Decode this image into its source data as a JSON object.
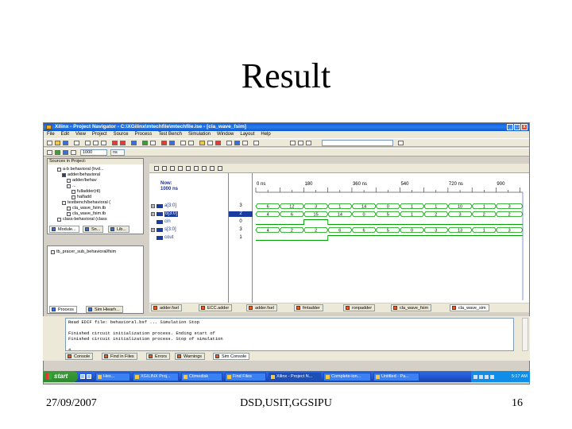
{
  "slide": {
    "title": "Result",
    "footer_left": "27/09/2007",
    "footer_center": "DSD,USIT,GGSIPU",
    "footer_right": "16"
  },
  "window": {
    "title": "Xilinx - Project Navigator - C:\\XGilinx\\mtechfile\\mtechfile.ise - [cla_wave_fsim]",
    "controls": [
      "_",
      "□",
      "x"
    ]
  },
  "menu": [
    "File",
    "Edit",
    "View",
    "Project",
    "Source",
    "Process",
    "Test Bench",
    "Simulation",
    "Window",
    "Layout",
    "Help"
  ],
  "toolbar": {
    "zoom_value": "1000",
    "zoom_unit": "ns"
  },
  "sources_panel": {
    "title": "Sources in Project:",
    "items": [
      "a-b behavioral (hvd...",
      "adder/behavioral",
      "adder/behav",
      "...",
      "fulladder(rtl)",
      "halfadd",
      "testbench/behavioral (",
      "cla_wave_fsim.tb",
      "cla_wave_fsim.tb",
      "class-behavioral (class"
    ],
    "tabs": [
      "Module...",
      "Sn...",
      "Lib..."
    ]
  },
  "process_panel": {
    "item": "tb_pracer_sub_behavioral/fsim",
    "tabs": [
      "Process",
      "Sim Hiearh..."
    ]
  },
  "wave": {
    "now_label": "Now:",
    "now_value": "1000 ns",
    "time_ticks": [
      "0 ns",
      "180",
      "360 ns",
      "540",
      "720 ns",
      "900"
    ],
    "signals": [
      {
        "name": "a[3:0]",
        "value": "3",
        "kind": "bus"
      },
      {
        "name": "b[3:0]",
        "value": "2",
        "kind": "bus"
      },
      {
        "name": "cin",
        "value": "0",
        "kind": "bit"
      },
      {
        "name": "s[3:0]",
        "value": "3",
        "kind": "bus"
      },
      {
        "name": "cout",
        "value": "1",
        "kind": "bit"
      }
    ],
    "tabs": [
      "adder.fsel",
      "ECC.adder",
      "adder.fsel",
      "fmtadder",
      "ronpadder",
      "cla_wave_fsim",
      "cla_wave_sim"
    ]
  },
  "chart_data": {
    "type": "timing",
    "x_unit": "ns",
    "xlim": [
      0,
      1000
    ],
    "buses": [
      {
        "name": "a[3:0]",
        "segments": [
          [
            0,
            90,
            "6"
          ],
          [
            90,
            180,
            "12"
          ],
          [
            180,
            270,
            "3"
          ],
          [
            270,
            360,
            "1"
          ],
          [
            360,
            450,
            "14"
          ],
          [
            450,
            540,
            "0"
          ],
          [
            540,
            630,
            "1"
          ],
          [
            630,
            720,
            "1"
          ],
          [
            720,
            810,
            "10"
          ],
          [
            810,
            900,
            "1"
          ],
          [
            900,
            1000,
            "3"
          ]
        ]
      },
      {
        "name": "b[3:0]",
        "segments": [
          [
            0,
            90,
            "4"
          ],
          [
            90,
            180,
            "6"
          ],
          [
            180,
            270,
            "15"
          ],
          [
            270,
            360,
            "14"
          ],
          [
            360,
            450,
            "0"
          ],
          [
            450,
            540,
            "5"
          ],
          [
            540,
            630,
            "1"
          ],
          [
            630,
            720,
            "2"
          ],
          [
            720,
            810,
            "3"
          ],
          [
            810,
            900,
            "2"
          ],
          [
            900,
            1000,
            "2"
          ]
        ]
      },
      {
        "name": "s[3:0]",
        "segments": [
          [
            0,
            90,
            "4"
          ],
          [
            90,
            180,
            "2"
          ],
          [
            180,
            270,
            "2"
          ],
          [
            270,
            360,
            "6"
          ],
          [
            360,
            450,
            "6"
          ],
          [
            450,
            540,
            "5"
          ],
          [
            540,
            630,
            "0"
          ],
          [
            630,
            720,
            "3"
          ],
          [
            720,
            810,
            "13"
          ],
          [
            810,
            900,
            "1"
          ],
          [
            900,
            1000,
            "3"
          ]
        ]
      }
    ],
    "bits": [
      {
        "name": "cin",
        "edges": [
          [
            0,
            0
          ],
          [
            90,
            0
          ],
          [
            180,
            1
          ],
          [
            270,
            0
          ],
          [
            1000,
            0
          ]
        ]
      },
      {
        "name": "cout",
        "edges": [
          [
            0,
            0
          ],
          [
            180,
            0
          ],
          [
            270,
            1
          ],
          [
            1000,
            1
          ]
        ]
      }
    ]
  },
  "console": {
    "lines": [
      "Read EDIF file: behavioral.bsf ... Simulation Stop",
      "",
      "Finished circuit initialization process. Ending start of",
      "Finished circuit initialization process. Stop of simulation",
      "",
      "# "
    ],
    "tabs": [
      "Console",
      "Find in Files",
      "Errors",
      "Warnings",
      "Sim Console"
    ]
  },
  "taskbar": {
    "start_label": "start",
    "buttons": [
      "Hex...",
      "XGILINX Proj...",
      "Ctimedisk",
      "Find Files",
      "Xilinx - Project N...",
      "Complete-ion...",
      "Untitled - Pa..."
    ],
    "clock": "5:17 AM"
  }
}
